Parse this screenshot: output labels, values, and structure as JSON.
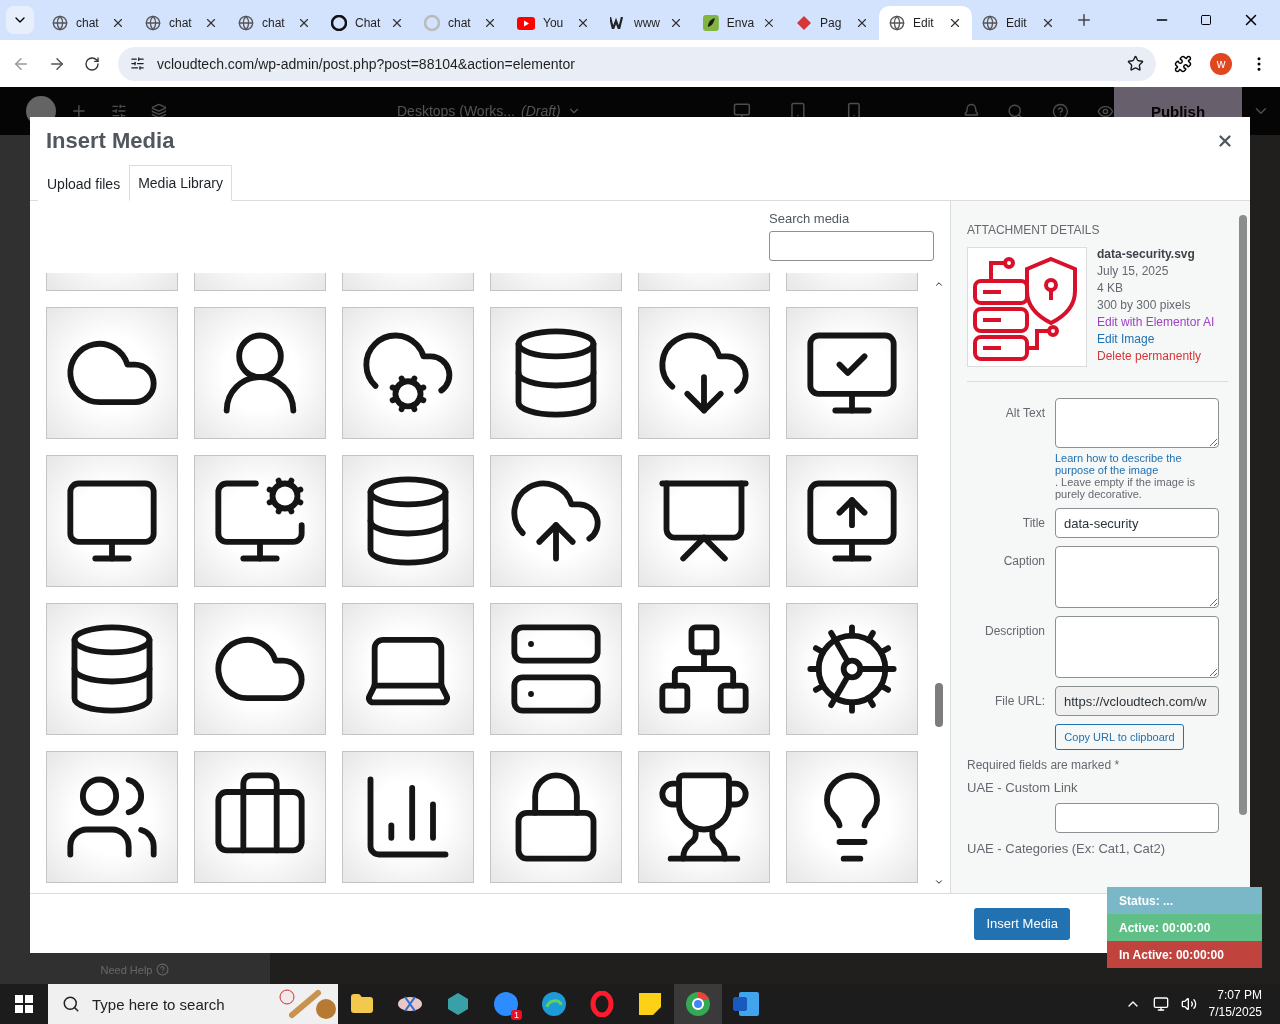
{
  "browser": {
    "tabs": [
      {
        "label": "chat",
        "kind": "globe",
        "selected": false
      },
      {
        "label": "chat",
        "kind": "globe",
        "selected": false
      },
      {
        "label": "chat",
        "kind": "globe",
        "selected": false
      },
      {
        "label": "Chat",
        "kind": "knot",
        "selected": false
      },
      {
        "label": "chat",
        "kind": "knot-faded",
        "selected": false
      },
      {
        "label": "You",
        "kind": "video",
        "selected": false
      },
      {
        "label": "www",
        "kind": "square",
        "selected": false
      },
      {
        "label": "Enva",
        "kind": "leaf",
        "selected": false
      },
      {
        "label": "Pag",
        "kind": "diamond",
        "selected": false
      },
      {
        "label": "Edit",
        "kind": "globe",
        "selected": true
      },
      {
        "label": "Edit",
        "kind": "globe",
        "selected": false
      }
    ],
    "address": "vcloudtech.com/wp-admin/post.php?post=88104&action=elementor",
    "profile_initial": "w"
  },
  "editor": {
    "document": "Desktops (Works...",
    "status": "(Draft)",
    "publish": "Publish",
    "help": "Need Help"
  },
  "modal": {
    "title": "Insert Media",
    "tabs": [
      {
        "label": "Upload files",
        "selected": false
      },
      {
        "label": "Media Library",
        "selected": true
      }
    ],
    "search_label": "Search media",
    "attachment": {
      "heading": "ATTACHMENT DETAILS",
      "filename": "data-security.svg",
      "date": "July 15, 2025",
      "size": "4 KB",
      "dimensions": "300 by 300 pixels",
      "actions": [
        {
          "label": "Edit with Elementor AI",
          "kind": "ai"
        },
        {
          "label": "Edit Image",
          "kind": "edit"
        },
        {
          "label": "Delete permanently",
          "kind": "delete"
        }
      ],
      "fields": [
        {
          "label": "Alt Text",
          "kind": "textarea",
          "help_link": "Learn how to describe the purpose of the image",
          "help_text": ". Leave empty if the image is purely decorative."
        },
        {
          "label": "Title",
          "kind": "input",
          "value": "data-security"
        },
        {
          "label": "Caption",
          "kind": "textarea"
        },
        {
          "label": "Description",
          "kind": "textarea"
        },
        {
          "label": "File URL:",
          "kind": "readonly",
          "value": "https://vcloudtech.com/w"
        }
      ],
      "copy_button": "Copy URL to clipboard",
      "required_note": "Required fields are marked *",
      "custom_link_label": "UAE - Custom Link",
      "categories_label": "UAE - Categories (Ex: Cat1, Cat2)"
    },
    "insert_button": "Insert Media"
  },
  "status_widget": [
    {
      "label": "Status: ...",
      "kind": "status"
    },
    {
      "label": "Active: 00:00:00",
      "kind": "active"
    },
    {
      "label": "In Active: 00:00:00",
      "kind": "inactive"
    }
  ],
  "taskbar": {
    "search_placeholder": "Type here to search",
    "badge": "1",
    "time": "7:07 PM",
    "date": "7/15/2025"
  }
}
